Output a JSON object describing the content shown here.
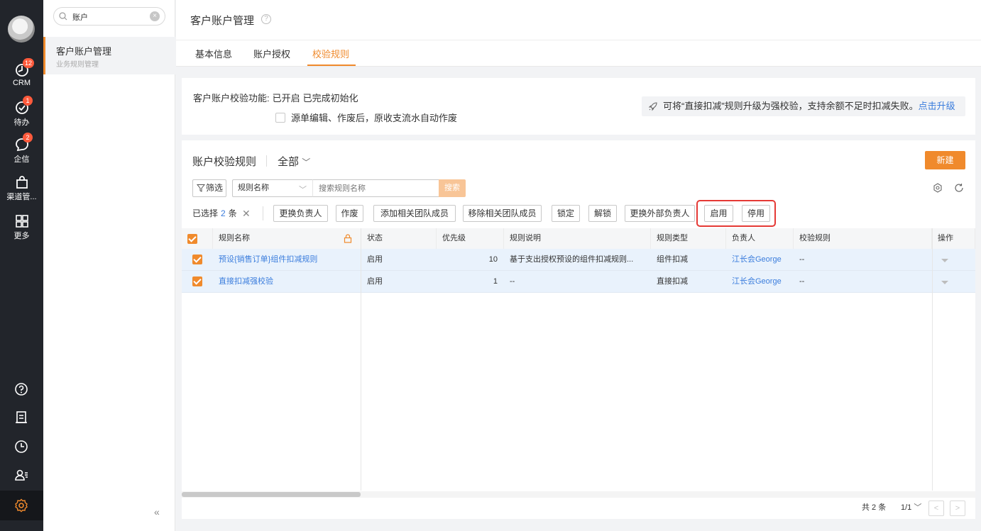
{
  "rail": {
    "items": [
      {
        "label": "CRM",
        "badge": "12",
        "icon": "crm-icon"
      },
      {
        "label": "待办",
        "badge": "1",
        "icon": "todo-icon"
      },
      {
        "label": "企信",
        "badge": "2",
        "icon": "chat-icon"
      },
      {
        "label": "渠道管...",
        "badge": "",
        "icon": "bag-icon"
      },
      {
        "label": "更多",
        "badge": "",
        "icon": "grid-icon"
      }
    ],
    "bottom_icons": [
      "help-icon",
      "notes-icon",
      "clock-icon",
      "user-list-icon",
      "settings-icon"
    ]
  },
  "subnav": {
    "search_value": "账户",
    "item_title": "客户账户管理",
    "item_subtitle": "业务规则管理",
    "collapse": "«"
  },
  "header": {
    "title": "客户账户管理",
    "help": "?",
    "tabs": [
      {
        "label": "基本信息",
        "active": false
      },
      {
        "label": "账户授权",
        "active": false
      },
      {
        "label": "校验规则",
        "active": true
      }
    ]
  },
  "info": {
    "feature_label": "客户账户校验功能:",
    "status1": "已开启",
    "status2": "已完成初始化",
    "checkbox_label": "源单编辑、作废后，原收支流水自动作废",
    "tip_text": "可将“直接扣减”规则升级为强校验，支持余额不足时扣减失败。",
    "tip_link": "点击升级"
  },
  "rules": {
    "title": "账户校验规则",
    "scope": "全部",
    "new_button": "新建",
    "filter_button": "筛选",
    "search_field": "规则名称",
    "search_placeholder": "搜索规则名称",
    "search_button": "搜索",
    "selected_prefix": "已选择",
    "selected_count": "2",
    "selected_suffix": "条",
    "batch_actions": [
      "更换负责人",
      "作废",
      "添加相关团队成员",
      "移除相关团队成员",
      "锁定",
      "解锁",
      "更换外部负责人",
      "启用",
      "停用"
    ],
    "columns": [
      "规则名称",
      "状态",
      "优先级",
      "规则说明",
      "规则类型",
      "负责人",
      "校验规则",
      "操作"
    ],
    "rows": [
      {
        "name": "预设{销售订单}组件扣减规则",
        "status": "启用",
        "priority": "10",
        "desc": "基于支出授权预设的组件扣减规则...",
        "type": "组件扣减",
        "owner": "江长会George",
        "check": "--"
      },
      {
        "name": "直接扣减强校验",
        "status": "启用",
        "priority": "1",
        "desc": "--",
        "type": "直接扣减",
        "owner": "江长会George",
        "check": "--"
      }
    ],
    "pager_total": "共 2 条",
    "pager_page": "1/1"
  },
  "colors": {
    "accent": "#f08a2c",
    "link": "#3b7ddd",
    "rail": "#22252b",
    "highlight": "#e53935"
  }
}
